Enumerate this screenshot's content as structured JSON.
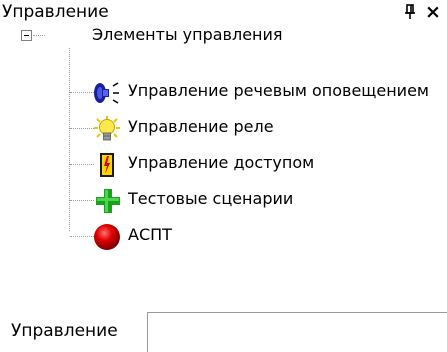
{
  "panel": {
    "title": "Управление",
    "pin_glyph": "ᵖ",
    "close_glyph": "×"
  },
  "tree": {
    "root_label": "Элементы управления",
    "expander_state": "expanded",
    "items": [
      {
        "label": "Управление речевым оповещением",
        "icon": "loudspeaker-icon"
      },
      {
        "label": "Управление реле",
        "icon": "lightbulb-icon"
      },
      {
        "label": "Управление доступом",
        "icon": "access-door-icon"
      },
      {
        "label": "Тестовые сценарии",
        "icon": "green-plus-icon"
      },
      {
        "label": "АСПТ",
        "icon": "red-ball-icon"
      }
    ]
  },
  "tabs": [
    {
      "label": "Управление",
      "active": true
    }
  ]
}
